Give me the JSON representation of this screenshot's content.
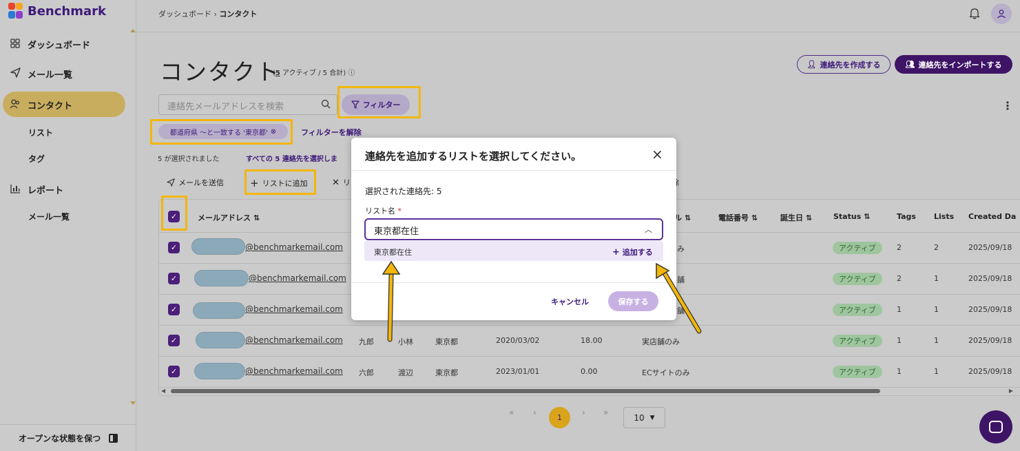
{
  "app": {
    "logo_text": "Benchmark"
  },
  "sidebar": {
    "items": [
      {
        "label": "ダッシュボード",
        "icon": "grid-icon"
      },
      {
        "label": "メール一覧",
        "icon": "send-icon"
      },
      {
        "label": "コンタクト",
        "icon": "contacts-icon"
      },
      {
        "label": "リスト"
      },
      {
        "label": "タグ"
      },
      {
        "label": "レポート",
        "icon": "bar-chart-icon"
      },
      {
        "label": "メール一覧"
      }
    ],
    "footer": "オープンな状態を保つ"
  },
  "breadcrumb": {
    "parent": "ダッシュボード",
    "sep": "›",
    "current": "コンタクト"
  },
  "page": {
    "title": "コンタクト",
    "sub_open": "(",
    "active_count": "5",
    "sub_rest": " アクティブ / 5 合計)",
    "create_label": "連絡先を作成する",
    "import_label": "連絡先をインポートする"
  },
  "search": {
    "placeholder": "連絡先メールアドレスを検索"
  },
  "filter": {
    "button_label": "フィルター",
    "chip_label": "都道府県 〜と一致する '東京都'",
    "clear_label": "フィルターを解除"
  },
  "selection": {
    "count_text": "5 が選択されました",
    "select_all": "すべての 5 連絡先を選択しま"
  },
  "actions": {
    "send_email": "メールを送信",
    "add_to_list": "リストに追加",
    "remove_partial": "リ",
    "delete_partial": "除"
  },
  "table": {
    "headers": [
      "メールアドレス ⇅",
      "ネル ⇅",
      "電話番号 ⇅",
      "誕生日 ⇅",
      "Status ⇅",
      "Tags",
      "Lists",
      "Created Da"
    ],
    "rows": [
      {
        "email": "@benchmarkemail.com",
        "c1": "",
        "c2": "",
        "c3": "",
        "c4": "",
        "c5": "",
        "channel": "み",
        "status": "アクティブ",
        "tags": "2",
        "lists": "2",
        "created": "2025/09/18"
      },
      {
        "email": "@benchmarkemail.com",
        "c1": "",
        "c2": "",
        "c3": "",
        "c4": "",
        "c5": "",
        "channel": "舗",
        "status": "アクティブ",
        "tags": "2",
        "lists": "1",
        "created": "2025/09/18"
      },
      {
        "email": "@benchmarkemail.com",
        "c1": "",
        "c2": "",
        "c3": "",
        "c4": "",
        "c5": "",
        "channel": "舗",
        "status": "アクティブ",
        "tags": "1",
        "lists": "1",
        "created": "2025/09/18"
      },
      {
        "email": "@benchmarkemail.com",
        "c1": "九郎",
        "c2": "小林",
        "c3": "東京都",
        "c4": "2020/03/02",
        "c5": "18.00",
        "channel": "実店舗のみ",
        "status": "アクティブ",
        "tags": "1",
        "lists": "1",
        "created": "2025/09/18"
      },
      {
        "email": "@benchmarkemail.com",
        "c1": "六郎",
        "c2": "渡辺",
        "c3": "東京都",
        "c4": "2023/01/01",
        "c5": "0.00",
        "channel": "ECサイトのみ",
        "status": "アクティブ",
        "tags": "1",
        "lists": "1",
        "created": "2025/09/18"
      }
    ]
  },
  "pagination": {
    "first": "«",
    "prev": "‹",
    "current": "1",
    "next": "›",
    "last": "»",
    "page_size": "10"
  },
  "modal": {
    "title": "連絡先を追加するリストを選択してください。",
    "selected_text": "選択された連絡先: 5",
    "list_label": "リスト名",
    "required_mark": "*",
    "select_value": "東京都在住",
    "option_label": "東京都在住",
    "add_label": "追加する",
    "cancel_label": "キャンセル",
    "save_label": "保存する"
  },
  "colors": {
    "brand": "#3e1466",
    "highlight": "#f3b60a",
    "active_badge": "#9fc59f"
  }
}
